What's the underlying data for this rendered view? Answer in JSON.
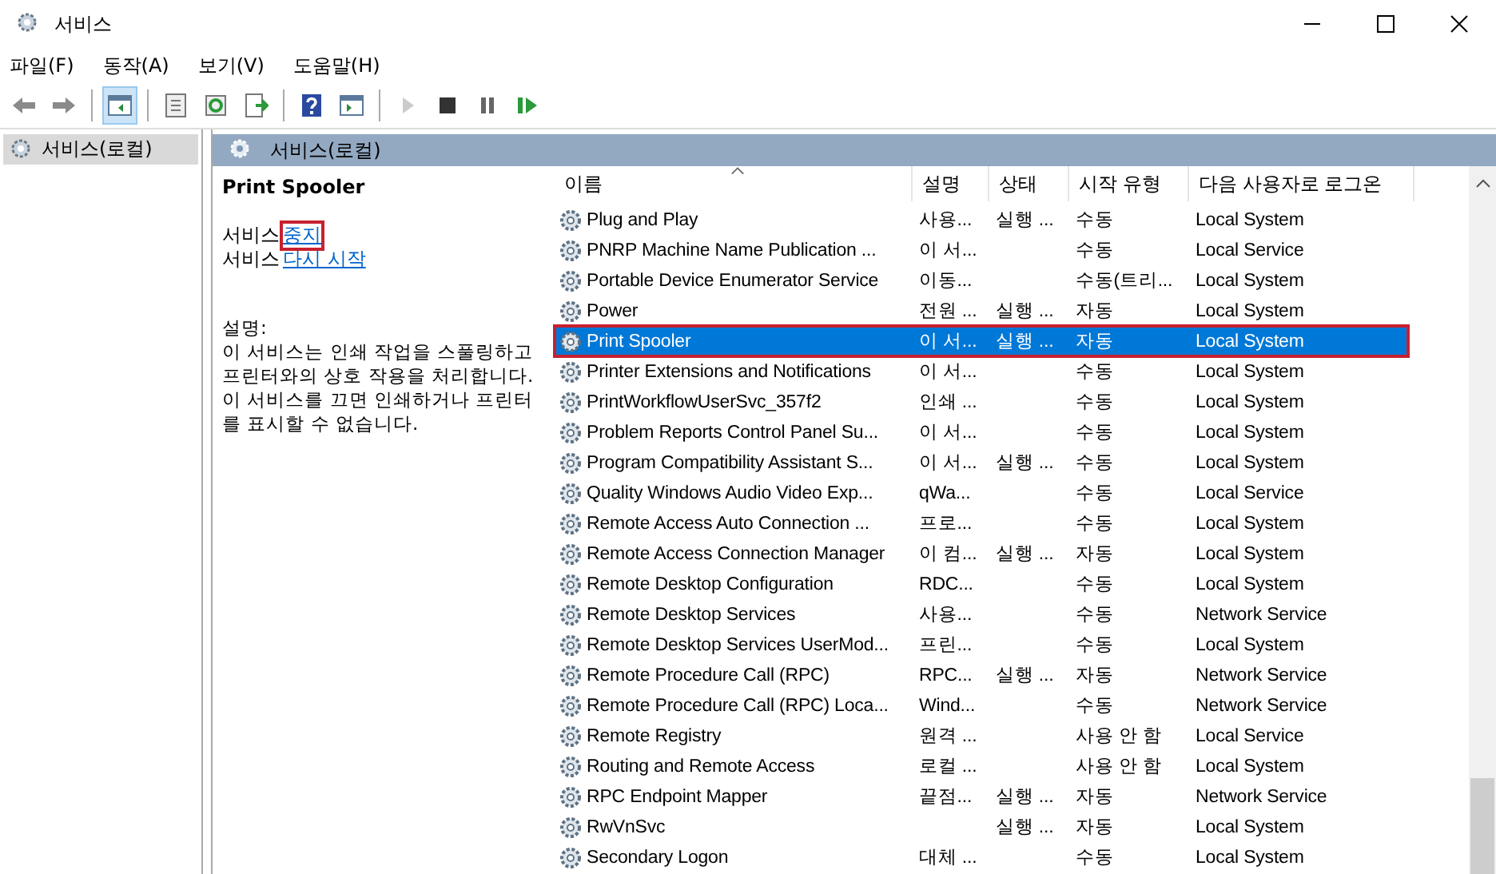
{
  "window": {
    "title": "서비스"
  },
  "menu": [
    "파일(F)",
    "동작(A)",
    "보기(V)",
    "도움말(H)"
  ],
  "toolbar": [
    {
      "kind": "back",
      "selected": false,
      "disabled": false
    },
    {
      "kind": "forward",
      "selected": false,
      "disabled": false
    },
    {
      "kind": "sep"
    },
    {
      "kind": "tree",
      "selected": true,
      "disabled": false
    },
    {
      "kind": "sep"
    },
    {
      "kind": "properties",
      "selected": false,
      "disabled": false
    },
    {
      "kind": "refresh",
      "selected": false,
      "disabled": false
    },
    {
      "kind": "export",
      "selected": false,
      "disabled": false
    },
    {
      "kind": "sep"
    },
    {
      "kind": "help",
      "selected": false,
      "disabled": false
    },
    {
      "kind": "view",
      "selected": false,
      "disabled": false
    },
    {
      "kind": "sep"
    },
    {
      "kind": "play",
      "selected": false,
      "disabled": true
    },
    {
      "kind": "stop",
      "selected": false,
      "disabled": false
    },
    {
      "kind": "pause",
      "selected": false,
      "disabled": false
    },
    {
      "kind": "resume",
      "selected": false,
      "disabled": false
    }
  ],
  "tree": {
    "items": [
      {
        "label": "서비스(로컬)",
        "selected": true
      }
    ]
  },
  "pane": {
    "title": "서비스(로컬)",
    "detail": {
      "name": "Print Spooler",
      "actions": [
        {
          "prefix": "서비스",
          "link": "중지",
          "highlighted": true
        },
        {
          "prefix": "서비스",
          "link": "다시 시작",
          "highlighted": false
        }
      ],
      "description_label": "설명:",
      "description": "이 서비스는 인쇄 작업을 스풀링하고 프린터와의 상호 작용을 처리합니다. 이 서비스를 끄면 인쇄하거나 프린터를 표시할 수 없습니다."
    },
    "table": {
      "columns": [
        "이름",
        "설명",
        "상태",
        "시작 유형",
        "다음 사용자로 로그온"
      ],
      "rows": [
        {
          "cells": [
            "Plug and Play",
            "사용...",
            "실행 ...",
            "수동",
            "Local System"
          ],
          "selected": false,
          "highlighted": false
        },
        {
          "cells": [
            "PNRP Machine Name Publication ...",
            "이 서...",
            "",
            "수동",
            "Local Service"
          ],
          "selected": false,
          "highlighted": false
        },
        {
          "cells": [
            "Portable Device Enumerator Service",
            "이동...",
            "",
            "수동(트리...",
            "Local System"
          ],
          "selected": false,
          "highlighted": false
        },
        {
          "cells": [
            "Power",
            "전원 ...",
            "실행 ...",
            "자동",
            "Local System"
          ],
          "selected": false,
          "highlighted": false
        },
        {
          "cells": [
            "Print Spooler",
            "이 서...",
            "실행 ...",
            "자동",
            "Local System"
          ],
          "selected": true,
          "highlighted": true
        },
        {
          "cells": [
            "Printer Extensions and Notifications",
            "이 서...",
            "",
            "수동",
            "Local System"
          ],
          "selected": false,
          "highlighted": false
        },
        {
          "cells": [
            "PrintWorkflowUserSvc_357f2",
            "인쇄 ...",
            "",
            "수동",
            "Local System"
          ],
          "selected": false,
          "highlighted": false
        },
        {
          "cells": [
            "Problem Reports Control Panel Su...",
            "이 서...",
            "",
            "수동",
            "Local System"
          ],
          "selected": false,
          "highlighted": false
        },
        {
          "cells": [
            "Program Compatibility Assistant S...",
            "이 서...",
            "실행 ...",
            "수동",
            "Local System"
          ],
          "selected": false,
          "highlighted": false
        },
        {
          "cells": [
            "Quality Windows Audio Video Exp...",
            "qWa...",
            "",
            "수동",
            "Local Service"
          ],
          "selected": false,
          "highlighted": false
        },
        {
          "cells": [
            "Remote Access Auto Connection ...",
            "프로...",
            "",
            "수동",
            "Local System"
          ],
          "selected": false,
          "highlighted": false
        },
        {
          "cells": [
            "Remote Access Connection Manager",
            "이 컴...",
            "실행 ...",
            "자동",
            "Local System"
          ],
          "selected": false,
          "highlighted": false
        },
        {
          "cells": [
            "Remote Desktop Configuration",
            "RDC...",
            "",
            "수동",
            "Local System"
          ],
          "selected": false,
          "highlighted": false
        },
        {
          "cells": [
            "Remote Desktop Services",
            "사용...",
            "",
            "수동",
            "Network Service"
          ],
          "selected": false,
          "highlighted": false
        },
        {
          "cells": [
            "Remote Desktop Services UserMod...",
            "프린...",
            "",
            "수동",
            "Local System"
          ],
          "selected": false,
          "highlighted": false
        },
        {
          "cells": [
            "Remote Procedure Call (RPC)",
            "RPC...",
            "실행 ...",
            "자동",
            "Network Service"
          ],
          "selected": false,
          "highlighted": false
        },
        {
          "cells": [
            "Remote Procedure Call (RPC) Loca...",
            "Wind...",
            "",
            "수동",
            "Network Service"
          ],
          "selected": false,
          "highlighted": false
        },
        {
          "cells": [
            "Remote Registry",
            "원격 ...",
            "",
            "사용 안 함",
            "Local Service"
          ],
          "selected": false,
          "highlighted": false
        },
        {
          "cells": [
            "Routing and Remote Access",
            "로컬 ...",
            "",
            "사용 안 함",
            "Local System"
          ],
          "selected": false,
          "highlighted": false
        },
        {
          "cells": [
            "RPC Endpoint Mapper",
            "끝점...",
            "실행 ...",
            "자동",
            "Network Service"
          ],
          "selected": false,
          "highlighted": false
        },
        {
          "cells": [
            "RwVnSvc",
            "",
            "실행 ...",
            "자동",
            "Local System"
          ],
          "selected": false,
          "highlighted": false
        },
        {
          "cells": [
            "Secondary Logon",
            "대체 ...",
            "",
            "수동",
            "Local System"
          ],
          "selected": false,
          "highlighted": false
        }
      ]
    }
  }
}
